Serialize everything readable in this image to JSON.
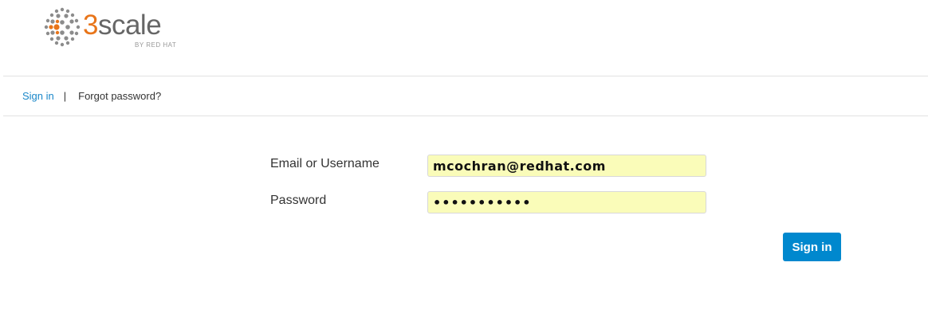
{
  "brand": {
    "logo_digit": "3",
    "logo_word": "scale",
    "byline": "BY RED HAT",
    "logo_icon": "dotted-circle-logo",
    "accent_color": "#e8751a"
  },
  "nav": {
    "sign_in_label": "Sign in",
    "separator": "|",
    "forgot_password_label": "Forgot password?"
  },
  "form": {
    "username_label": "Email or Username",
    "username_value": "mcochran@redhat.com",
    "password_label": "Password",
    "password_value": "•••••••••••",
    "submit_label": "Sign in",
    "field_highlight_color": "#fafcb9",
    "button_color": "#0088ce"
  }
}
